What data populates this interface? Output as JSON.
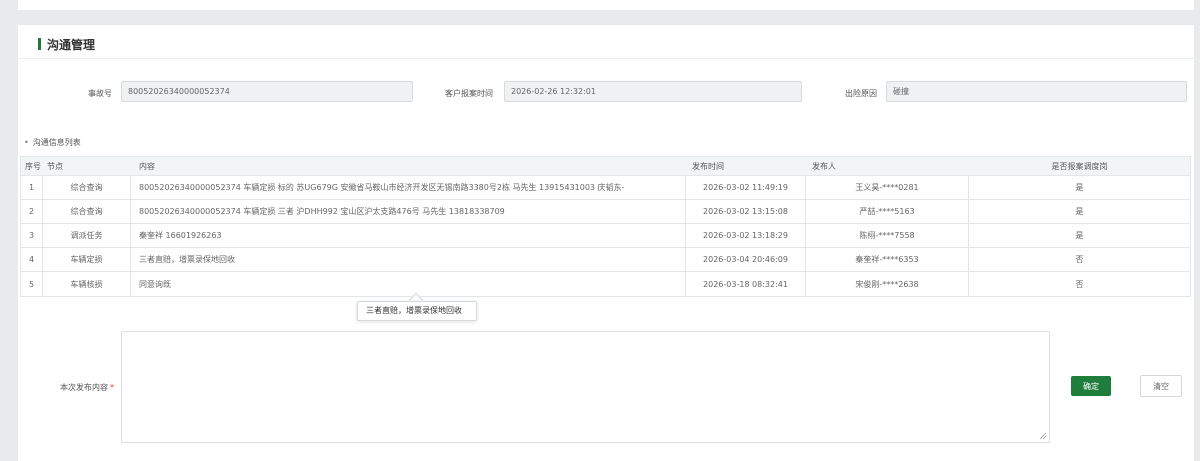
{
  "section": {
    "title": "沟通管理"
  },
  "form": {
    "accident_no_label": "事故号",
    "accident_no_value": "80052026340000052374",
    "report_time_label": "客户报案时间",
    "report_time_value": "2026-02-26 12:32:01",
    "reason_label": "出险原因",
    "reason_value": "碰撞"
  },
  "list": {
    "title": "沟通信息列表",
    "headers": {
      "no": "序号",
      "node": "节点",
      "content": "内容",
      "time": "发布时间",
      "publisher": "发布人",
      "is_dispatch": "是否报案调度岗"
    },
    "rows": [
      {
        "no": "1",
        "node": "综合查询",
        "content": "80052026340000052374 车辆定损 标的 苏UG679G 安徽省马鞍山市经济开发区无锡南路3380号2栋 马先生 13915431003 庆韬东-",
        "time": "2026-03-02 11:49:19",
        "publisher": "王义昊-****0281",
        "is_dispatch": "是"
      },
      {
        "no": "2",
        "node": "综合查询",
        "content": "80052026340000052374 车辆定损 三者 沪DHH992 宝山区沪太支路476号 马先生 13818338709",
        "time": "2026-03-02 13:15:08",
        "publisher": "严喆-****5163",
        "is_dispatch": "是"
      },
      {
        "no": "3",
        "node": "调派任务",
        "content": "秦奎祥 16601926263",
        "time": "2026-03-02 13:18:29",
        "publisher": "陈栩-****7558",
        "is_dispatch": "是"
      },
      {
        "no": "4",
        "node": "车辆定损",
        "content": "三者直赔，增票录保地回收",
        "time": "2026-03-04 20:46:09",
        "publisher": "秦奎祥-****6353",
        "is_dispatch": "否"
      },
      {
        "no": "5",
        "node": "车辆核损",
        "content": "同意询既",
        "time": "2026-03-18 08:32:41",
        "publisher": "宋俊刚-****2638",
        "is_dispatch": "否"
      }
    ]
  },
  "tooltip": {
    "text": "三者直赔，增票录保地回收"
  },
  "publish": {
    "label": "本次发布内容",
    "required_mark": "*",
    "value": "",
    "confirm_label": "确定",
    "clear_label": "清空"
  },
  "colors": {
    "accent": "#1f7e3c",
    "required": "#e0362c",
    "table_header_bg": "#f1f5f6"
  }
}
